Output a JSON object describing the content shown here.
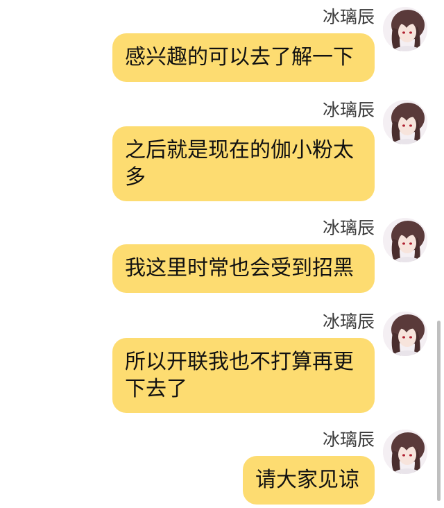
{
  "chat": {
    "messages": [
      {
        "sender": "冰璃辰",
        "text": "感兴趣的可以去了解一下"
      },
      {
        "sender": "冰璃辰",
        "text": "之后就是现在的伽小粉太多"
      },
      {
        "sender": "冰璃辰",
        "text": "我这里时常也会受到招黑"
      },
      {
        "sender": "冰璃辰",
        "text": "所以开联我也不打算再更下去了"
      },
      {
        "sender": "冰璃辰",
        "text": "请大家见谅"
      }
    ]
  },
  "colors": {
    "bubble": "#fddc71",
    "background": "#ffffff",
    "sender_text": "#3a3a3a"
  },
  "icons": {
    "avatar": "anime-girl-avatar"
  }
}
